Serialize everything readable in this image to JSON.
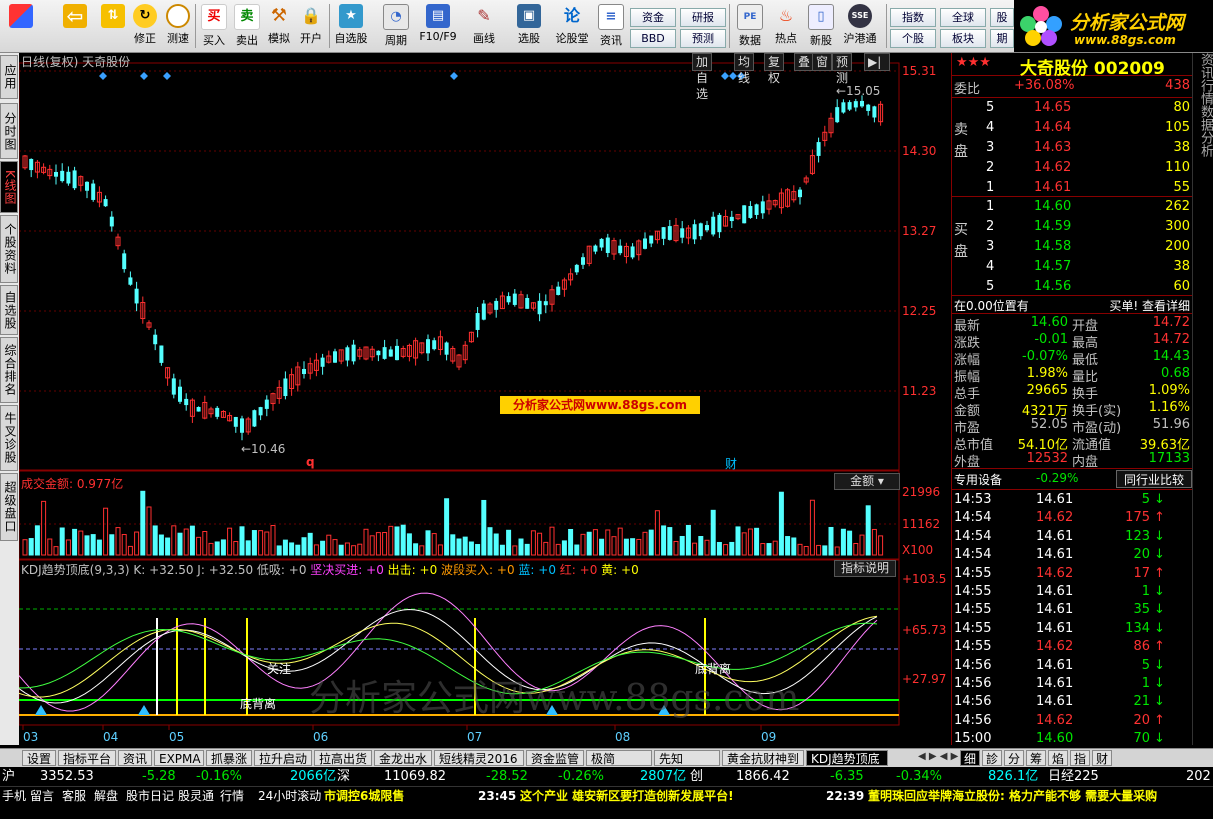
{
  "toolbar": {
    "buttons": [
      {
        "label": "修正"
      },
      {
        "label": "测速"
      },
      {
        "label": "买入"
      },
      {
        "label": "卖出"
      },
      {
        "label": "模拟"
      },
      {
        "label": "开户"
      },
      {
        "label": "自选股"
      },
      {
        "label": "周期"
      },
      {
        "label": "F10/F9"
      },
      {
        "label": "画线"
      },
      {
        "label": "选股"
      },
      {
        "label": "论股堂"
      },
      {
        "label": "资讯"
      }
    ],
    "small_buttons": [
      "资金",
      "BBD",
      "研报",
      "预测",
      "数据",
      "热点",
      "新股",
      "沪港通",
      "指数",
      "个股",
      "全球",
      "板块",
      "股",
      "期"
    ],
    "logo_title": "分析家公式网",
    "logo_url": "www.88gs.com"
  },
  "left_tabs": [
    "应用",
    "分时图",
    "K线图",
    "个股资料",
    "自选股",
    "综合排名",
    "牛叉诊股",
    "超级盘口"
  ],
  "chart": {
    "header_title": "日线(复权)  天奇股份",
    "header_buttons": [
      "加自选",
      "均线",
      "复权",
      "叠",
      "窗",
      "预测"
    ],
    "price_axis": [
      "15.31",
      "14.30",
      "13.27",
      "12.25",
      "11.23"
    ],
    "max_label": "15.05",
    "min_label": "10.46",
    "watermark_box": "分析家公式网www.88gs.com",
    "marker_q": "q",
    "marker_cai": "财",
    "volume_title": "成交金额: 0.977亿",
    "volume_button": "金额",
    "volume_axis": [
      "21996",
      "11162",
      "X100"
    ],
    "kdj_title_parts": [
      {
        "text": "KDJ趋势顶底(9,3,3)  K: +32.50  J: +32.50  低吸: +0  ",
        "color": "#c0c0c0"
      },
      {
        "text": "坚决买进: +0  ",
        "color": "#ff40ff"
      },
      {
        "text": "出击: +0  ",
        "color": "#ffff00"
      },
      {
        "text": "波段买入: +0  ",
        "color": "#ff9900"
      },
      {
        "text": "蓝: +0  ",
        "color": "#00c0ff"
      },
      {
        "text": "红: +0  ",
        "color": "#ff3030"
      },
      {
        "text": "黄: +0",
        "color": "#ffff00"
      }
    ],
    "kdj_button": "指标说明",
    "kdj_axis": [
      "+103.5",
      "+65.73",
      "+27.97"
    ],
    "kdj_labels": {
      "guanzhu": "关注",
      "dibeili1": "底背离",
      "dibeili2": "底背离",
      "watermark": "分析家公式网www.88gs.com"
    },
    "month_labels": [
      "03",
      "04",
      "05",
      "06",
      "07",
      "08",
      "09"
    ]
  },
  "right_panel": {
    "title": "大奇股份 002009",
    "weibi_label": "委比",
    "weibi_value": "+36.08%",
    "weicha_value": "438",
    "sell_label": "卖盘",
    "buy_label": "买盘",
    "sell": [
      {
        "n": "5",
        "p": "14.65",
        "v": "80"
      },
      {
        "n": "4",
        "p": "14.64",
        "v": "105"
      },
      {
        "n": "3",
        "p": "14.63",
        "v": "38"
      },
      {
        "n": "2",
        "p": "14.62",
        "v": "110"
      },
      {
        "n": "1",
        "p": "14.61",
        "v": "55"
      }
    ],
    "buy": [
      {
        "n": "1",
        "p": "14.60",
        "v": "262"
      },
      {
        "n": "2",
        "p": "14.59",
        "v": "300"
      },
      {
        "n": "3",
        "p": "14.58",
        "v": "200"
      },
      {
        "n": "4",
        "p": "14.57",
        "v": "38"
      },
      {
        "n": "5",
        "p": "14.56",
        "v": "60"
      }
    ],
    "position_text": "在0.00位置有",
    "detail_text": "买单! 查看详细",
    "stats": [
      {
        "l1": "最新",
        "v1": "14.60",
        "c1": "green",
        "l2": "开盘",
        "v2": "14.72",
        "c2": "red"
      },
      {
        "l1": "涨跌",
        "v1": "-0.01",
        "c1": "green",
        "l2": "最高",
        "v2": "14.72",
        "c2": "red"
      },
      {
        "l1": "涨幅",
        "v1": "-0.07%",
        "c1": "green",
        "l2": "最低",
        "v2": "14.43",
        "c2": "green"
      },
      {
        "l1": "振幅",
        "v1": "1.98%",
        "c1": "yel",
        "l2": "量比",
        "v2": "0.68",
        "c2": "green"
      },
      {
        "l1": "总手",
        "v1": "29665",
        "c1": "yel",
        "l2": "换手",
        "v2": "1.09%",
        "c2": "yel"
      },
      {
        "l1": "金额",
        "v1": "4321万",
        "c1": "yel",
        "l2": "换手(实)",
        "v2": "1.16%",
        "c2": "yel"
      },
      {
        "l1": "市盈",
        "v1": "52.05",
        "c1": "gray",
        "l2": "市盈(动)",
        "v2": "51.96",
        "c2": "gray"
      },
      {
        "l1": "总市值",
        "v1": "54.10亿",
        "c1": "yel",
        "l2": "流通值",
        "v2": "39.63亿",
        "c2": "yel"
      },
      {
        "l1": "外盘",
        "v1": "12532",
        "c1": "red",
        "l2": "内盘",
        "v2": "17133",
        "c2": "green"
      }
    ],
    "industry_label": "专用设备",
    "industry_change": "-0.29%",
    "industry_button": "同行业比较",
    "ticks": [
      {
        "t": "14:53",
        "p": "14.61",
        "c": "wh",
        "v": "5",
        "d": "down"
      },
      {
        "t": "14:54",
        "p": "14.62",
        "c": "red",
        "v": "175",
        "d": "up"
      },
      {
        "t": "14:54",
        "p": "14.61",
        "c": "wh",
        "v": "123",
        "d": "down"
      },
      {
        "t": "14:54",
        "p": "14.61",
        "c": "wh",
        "v": "20",
        "d": "down"
      },
      {
        "t": "14:55",
        "p": "14.62",
        "c": "red",
        "v": "17",
        "d": "up"
      },
      {
        "t": "14:55",
        "p": "14.61",
        "c": "wh",
        "v": "1",
        "d": "down"
      },
      {
        "t": "14:55",
        "p": "14.61",
        "c": "wh",
        "v": "35",
        "d": "down"
      },
      {
        "t": "14:55",
        "p": "14.61",
        "c": "wh",
        "v": "134",
        "d": "down"
      },
      {
        "t": "14:55",
        "p": "14.62",
        "c": "red",
        "v": "86",
        "d": "up"
      },
      {
        "t": "14:56",
        "p": "14.61",
        "c": "wh",
        "v": "5",
        "d": "down"
      },
      {
        "t": "14:56",
        "p": "14.61",
        "c": "wh",
        "v": "1",
        "d": "down"
      },
      {
        "t": "14:56",
        "p": "14.61",
        "c": "wh",
        "v": "21",
        "d": "down"
      },
      {
        "t": "14:56",
        "p": "14.62",
        "c": "red",
        "v": "20",
        "d": "up"
      },
      {
        "t": "15:00",
        "p": "14.60",
        "c": "green",
        "v": "70",
        "d": "down"
      }
    ],
    "side_strip": "资讯行情数据分析",
    "bottom_tabs": [
      "细",
      "診",
      "分",
      "筹",
      "焰",
      "指",
      "财"
    ]
  },
  "bottom_tabs": [
    "设置",
    "指标平台",
    "资讯",
    "EXPMA",
    "抓暴涨",
    "拉升启动",
    "拉高出货",
    "金龙出水",
    "短线精灵2016",
    "资金监管",
    "极简MACD",
    "先知MACD",
    "黄金抗财神到",
    "KDJ趋势顶底"
  ],
  "status1": {
    "sh_label": "沪",
    "sh_index": "3352.53",
    "sh_chg": "-5.28",
    "sh_pct": "-0.16%",
    "sh_amt": "2066亿",
    "sz_label": "深",
    "sz_index": "11069.82",
    "sz_chg": "-28.52",
    "sz_pct": "-0.26%",
    "sz_amt": "2807亿",
    "cy_label": "创",
    "cy_index": "1866.42",
    "cy_chg": "-6.35",
    "cy_pct": "-0.34%",
    "cy_amt": "826.1亿",
    "extra": "日经225",
    "extra_val": "202"
  },
  "status2": {
    "items": [
      "手机",
      "留言",
      "客服",
      "解盘",
      "股市日记",
      "股灵通",
      "行情",
      "24小时滚动"
    ],
    "news1": "市调控6城限售",
    "time2": "23:45",
    "news2": "这个产业  雄安新区要打造创新发展平台!",
    "time3": "22:39",
    "news3": "董明珠回应举牌海立股份: 格力产能不够 需要大量采购"
  }
}
